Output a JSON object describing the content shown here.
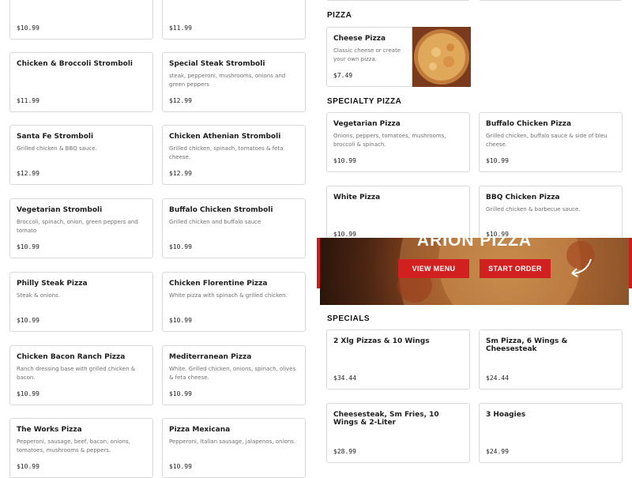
{
  "left_column": [
    {
      "name": "",
      "desc": "",
      "price": "$10.99"
    },
    {
      "name": "",
      "desc": "",
      "price": "$11.99"
    },
    {
      "name": "Chicken & Broccoli Stromboli",
      "desc": "",
      "price": "$11.99"
    },
    {
      "name": "Special Steak Stromboli",
      "desc": "steak, pepperoni, mushrooms, onions and green peppers",
      "price": "$12.99"
    },
    {
      "name": "Santa Fe Stromboli",
      "desc": "Grilled chicken & BBQ sauce.",
      "price": "$12.99"
    },
    {
      "name": "Chicken Athenian Stromboli",
      "desc": "Grilled chicken, spinach, tomatoes & feta cheese.",
      "price": "$12.99"
    },
    {
      "name": "Vegetarian Stromboli",
      "desc": "Broccoli, spinach, onion, green peppers and tomato",
      "price": "$10.99"
    },
    {
      "name": "Buffalo Chicken Stromboli",
      "desc": "Grilled chicken and buffalo sauce",
      "price": "$10.99"
    },
    {
      "name": "Philly Steak Pizza",
      "desc": "Steak & onions.",
      "price": "$10.99"
    },
    {
      "name": "Chicken Florentine Pizza",
      "desc": "White pizza with spinach & grilled chicken.",
      "price": "$10.99"
    },
    {
      "name": "Chicken Bacon Ranch Pizza",
      "desc": "Ranch dressing base with grilled chicken & bacon.",
      "price": "$10.99"
    },
    {
      "name": "Mediterranean Pizza",
      "desc": "White. Grilled chicken, onions, spinach, olives & feta cheese.",
      "price": "$10.99"
    },
    {
      "name": "The Works Pizza",
      "desc": "Pepperoni, sausage, beef, bacon, onions, tomatoes, mushrooms & peppers.",
      "price": "$10.99"
    },
    {
      "name": "Pizza Mexicana",
      "desc": "Pepperoni, Italian sausage, jalapenos, onions.",
      "price": "$10.99"
    }
  ],
  "sections": {
    "pizza": "PIZZA",
    "specialty": "SPECIALTY PIZZA",
    "specials": "SPECIALS"
  },
  "pizza_items": [
    {
      "name": "Cheese Pizza",
      "desc": "Classic cheese or create your own pizza.",
      "price": "$7.49"
    }
  ],
  "specialty_items": [
    {
      "name": "Vegetarian Pizza",
      "desc": "Onions, peppers, tomatoes, mushrooms, broccoli & spinach.",
      "price": "$10.99"
    },
    {
      "name": "Buffalo Chicken Pizza",
      "desc": "Grilled chicken, buffalo sauce & side of bleu cheese.",
      "price": "$10.99"
    },
    {
      "name": "White Pizza",
      "desc": "",
      "price": "$10.99"
    },
    {
      "name": "BBQ Chicken Pizza",
      "desc": "Grilled chicken & barbecue sauce.",
      "price": "$10.99"
    }
  ],
  "banner": {
    "title": "ARION PIZZA",
    "view_menu": "VIEW MENU",
    "start_order": "START ORDER"
  },
  "specials_items": [
    {
      "name": "2 Xlg Pizzas & 10 Wings",
      "desc": "",
      "price": "$34.44"
    },
    {
      "name": "Sm Pizza, 6 Wings & Cheesesteak",
      "desc": "",
      "price": "$24.44"
    },
    {
      "name": "Cheesesteak, Sm Fries, 10 Wings & 2-Liter",
      "desc": "",
      "price": "$28.99"
    },
    {
      "name": "3 Hoagies",
      "desc": "",
      "price": "$24.99"
    }
  ],
  "colors": {
    "accent": "#d22020",
    "border": "#d9d9d9"
  }
}
